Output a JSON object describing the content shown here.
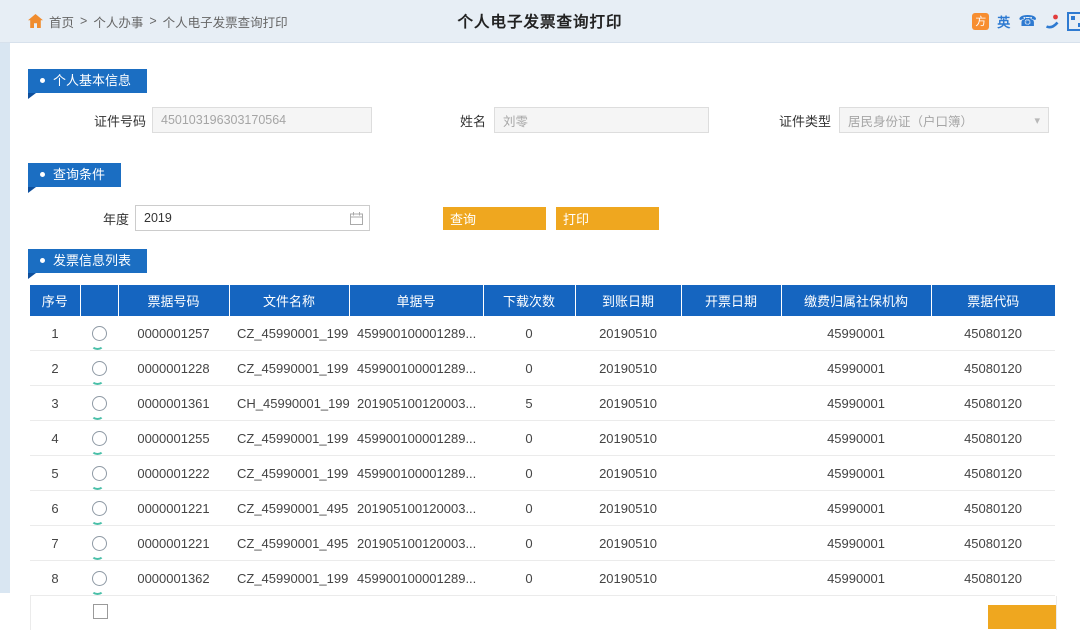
{
  "topbar": {
    "breadcrumb": {
      "separator": ">",
      "items": [
        "首页",
        "个人办事",
        "个人电子发票查询打印"
      ]
    },
    "title": "个人电子发票查询打印",
    "icons": {
      "badge": "方",
      "english": "英",
      "phone": "☎"
    }
  },
  "basic_info": {
    "title": "个人基本信息",
    "fields": {
      "id_number": {
        "label": "证件号码",
        "value": "450103196303170564"
      },
      "name": {
        "label": "姓名",
        "value": "刘零"
      },
      "id_type": {
        "label": "证件类型",
        "value": "居民身份证（户口簿）"
      }
    }
  },
  "query": {
    "title": "查询条件",
    "year_label": "年度",
    "year_value": "2019",
    "search_button": "查询",
    "print_button": "打印"
  },
  "list": {
    "title": "发票信息列表",
    "columns": [
      "序号",
      "",
      "票据号码",
      "文件名称",
      "单据号",
      "下载次数",
      "到账日期",
      "开票日期",
      "缴费归属社保机构",
      "票据代码"
    ],
    "rows": [
      [
        "1",
        "0000001257",
        "CZ_45990001_199...",
        "459900100001289...",
        "0",
        "20190510",
        "",
        "45990001",
        "45080120"
      ],
      [
        "2",
        "0000001228",
        "CZ_45990001_199...",
        "459900100001289...",
        "0",
        "20190510",
        "",
        "45990001",
        "45080120"
      ],
      [
        "3",
        "0000001361",
        "CH_45990001_199...",
        "201905100120003...",
        "5",
        "20190510",
        "",
        "45990001",
        "45080120"
      ],
      [
        "4",
        "0000001255",
        "CZ_45990001_199...",
        "459900100001289...",
        "0",
        "20190510",
        "",
        "45990001",
        "45080120"
      ],
      [
        "5",
        "0000001222",
        "CZ_45990001_199...",
        "459900100001289...",
        "0",
        "20190510",
        "",
        "45990001",
        "45080120"
      ],
      [
        "6",
        "0000001221",
        "CZ_45990001_495...",
        "201905100120003...",
        "0",
        "20190510",
        "",
        "45990001",
        "45080120"
      ],
      [
        "7",
        "0000001221",
        "CZ_45990001_495...",
        "201905100120003...",
        "0",
        "20190510",
        "",
        "45990001",
        "45080120"
      ],
      [
        "8",
        "0000001362",
        "CZ_45990001_199...",
        "459900100001289...",
        "0",
        "20190510",
        "",
        "45990001",
        "45080120"
      ]
    ]
  },
  "colors": {
    "ribbon_blue": "#1b6ec2",
    "table_header_blue": "#1565c0",
    "button_orange": "#efa71f",
    "topbar_bg": "#e7eef5",
    "left_strip": "#d9e6f2"
  }
}
